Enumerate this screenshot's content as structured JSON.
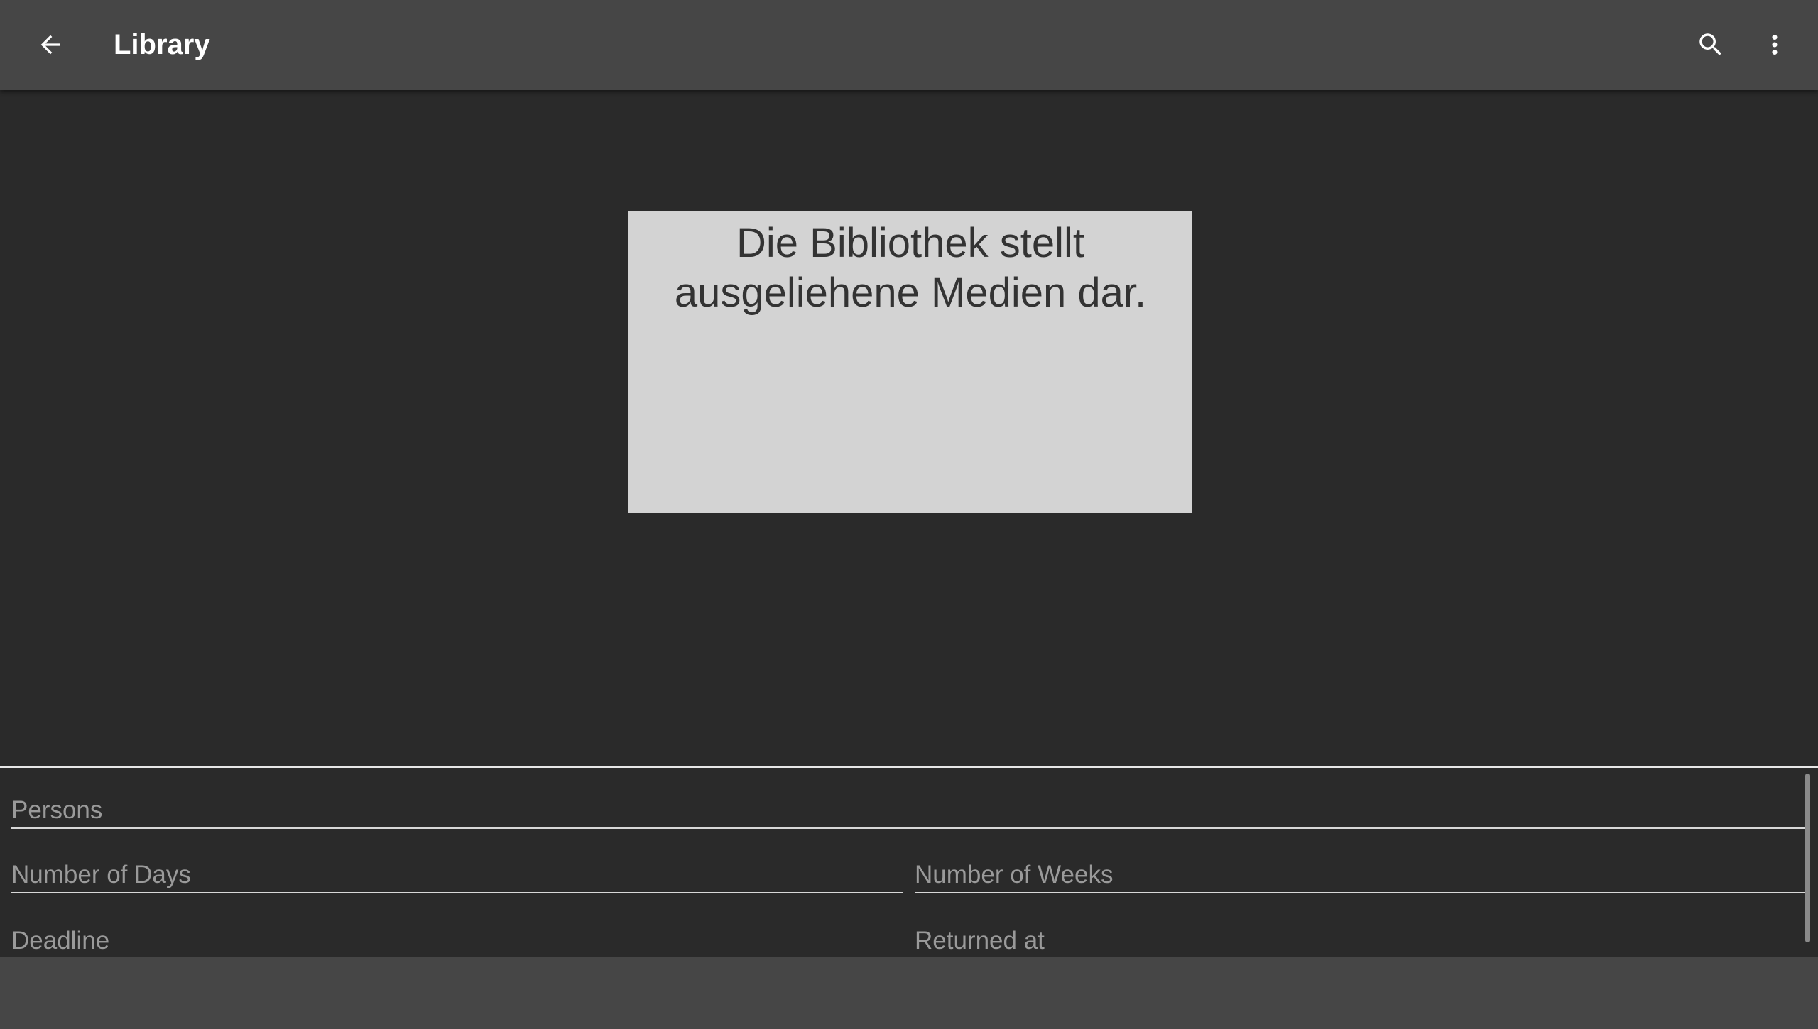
{
  "toolbar": {
    "title": "Library",
    "back_icon": "arrow-back-icon",
    "search_icon": "search-icon",
    "menu_icon": "more-vertical-icon",
    "background_color": "#464646"
  },
  "image_panel": {
    "line1": "Die Bibliothek stellt",
    "line2": "ausgeliehene Medien dar.",
    "background_color": "#d3d3d3"
  },
  "form": {
    "persons_label": "Persons",
    "days_label": "Number of Days",
    "weeks_label": "Number of Weeks",
    "deadline_label": "Deadline",
    "returned_label": "Returned at"
  },
  "theme": {
    "background": "#2a2a2a",
    "hint_text_color": "#9a9a9a"
  }
}
